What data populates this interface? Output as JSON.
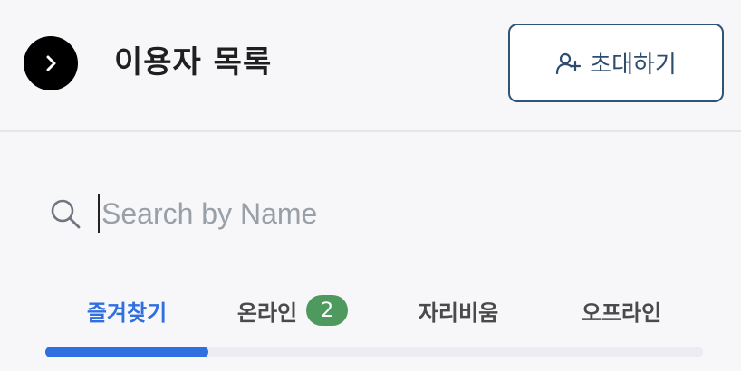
{
  "header": {
    "title": "이용자 목록",
    "back_icon": "chevron-right-icon",
    "invite_label": "초대하기",
    "invite_icon": "add-user-icon"
  },
  "search": {
    "placeholder": "Search by Name",
    "value": "",
    "icon": "search-icon"
  },
  "tabs": [
    {
      "label": "즐겨찾기",
      "active": true
    },
    {
      "label": "온라인",
      "badge": "2",
      "active": false
    },
    {
      "label": "자리비움",
      "active": false
    },
    {
      "label": "오프라인",
      "active": false
    }
  ],
  "colors": {
    "accent": "#2f6fe0",
    "badge": "#4e9a5e",
    "invite_border": "#2e5478",
    "background": "#f7f7fa"
  }
}
